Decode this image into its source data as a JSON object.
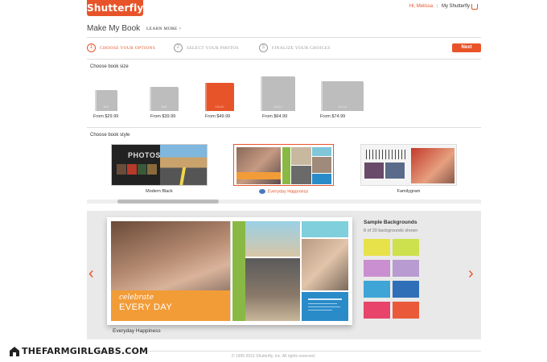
{
  "header": {
    "logo": "Shutterfly",
    "greeting": "Hi, Melissa",
    "my_account": "My Shutterfly",
    "cart_icon": "shopping-cart-icon"
  },
  "page": {
    "title": "Make My Book",
    "learn_more": "LEARN MORE >"
  },
  "steps": [
    {
      "num": "1",
      "label": "CHOOSE YOUR OPTIONS"
    },
    {
      "num": "2",
      "label": "SELECT YOUR PHOTOS"
    },
    {
      "num": "3",
      "label": "FINALIZE YOUR CHOICES"
    }
  ],
  "next_label": "Next",
  "book_size": {
    "heading": "Choose book size",
    "options": [
      {
        "label": "5x5",
        "price": "From $29.99"
      },
      {
        "label": "8x8",
        "price": "From $39.99"
      },
      {
        "label": "10x10",
        "price": "From $49.99"
      },
      {
        "label": "12x12",
        "price": "From $64.99"
      },
      {
        "label": "12x18",
        "price": "From $74.99"
      }
    ],
    "selected_index": 2
  },
  "book_style": {
    "heading": "Choose book style",
    "options": [
      {
        "name": "Modern Black"
      },
      {
        "name": "Everyday Happiness"
      },
      {
        "name": "Familygram"
      }
    ],
    "selected_index": 1,
    "modern_black_cover_text": "PHOTOS"
  },
  "preview": {
    "caption": "Everyday Happiness",
    "cover_line1": "celebrate",
    "cover_line2": "EVERY DAY",
    "sample_title": "Sample Backgrounds",
    "sample_count": "8 of 20 backgrounds shown",
    "swatch_colors": [
      "#e8e24a",
      "#cde04e",
      "#c98fd0",
      "#b79bd1",
      "#3fa5d6",
      "#2f6fb8",
      "#e8436a",
      "#ea5a3a"
    ]
  },
  "footer": "© 1999-2015 Shutterfly, Inc. All rights reserved.",
  "watermark": "THEFARMGIRLGABS.COM",
  "colors": {
    "accent": "#e8542a"
  }
}
